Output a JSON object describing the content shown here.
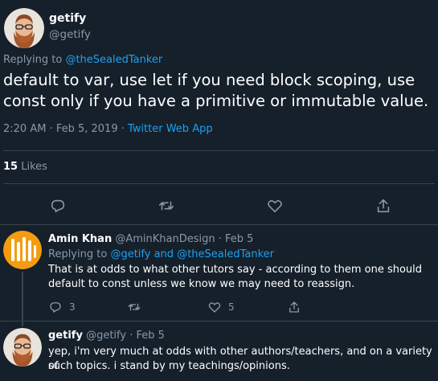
{
  "main_tweet": {
    "display_name": "getify",
    "handle": "@getify",
    "replying_prefix": "Replying to",
    "replying_to": "@theSealedTanker",
    "text": "default to var, use let if you need block scoping, use const only if you have a primitive or immutable value.",
    "time_date": "2:20 AM · Feb 5, 2019 ·",
    "source": "Twitter Web App",
    "likes_count": "15",
    "likes_label": "Likes"
  },
  "replies": [
    {
      "display_name": "Amin Khan",
      "handle": "@AminKhanDesign",
      "date": "· Feb 5",
      "replying_prefix": "Replying to",
      "replying_to_1": "@getify",
      "replying_and": "and",
      "replying_to_2": "@theSealedTanker",
      "text_line1": "That is at odds to what other tutors say - according to them one should",
      "text_line2": "default to const unless we know we may need to reassign.",
      "reply_count": "3",
      "like_count": "5"
    },
    {
      "display_name": "getify",
      "handle": "@getify",
      "date": "· Feb 5",
      "text_line1": "yep, i'm very much at odds with other authors/teachers, and on a variety of",
      "text_line2": "such topics. i stand by my teachings/opinions."
    }
  ],
  "colors": {
    "background": "#15202b",
    "link": "#1da1f2",
    "muted": "#8899a6",
    "border": "#38444d"
  },
  "icons": [
    "reply-icon",
    "retweet-icon",
    "like-icon",
    "share-icon"
  ]
}
